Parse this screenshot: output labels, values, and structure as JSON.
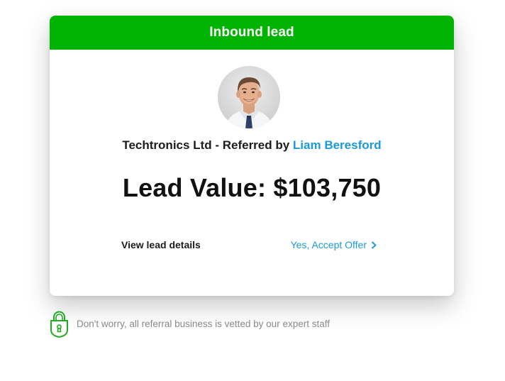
{
  "card": {
    "title": "Inbound lead",
    "header_color": "#00b300",
    "avatar_alt": "Liam Beresford",
    "company": "Techtronics Ltd",
    "referred_by_label": " - Referred by ",
    "referrer_name": "Liam Beresford",
    "lead_value_text": "Lead Value: $103,750",
    "view_details_label": "View lead details",
    "accept_offer_label": "Yes, Accept Offer",
    "link_color": "#1a9ad6"
  },
  "footer": {
    "icon": "lock-icon",
    "note": "Don't worry, all referral business is vetted by our expert staff"
  }
}
